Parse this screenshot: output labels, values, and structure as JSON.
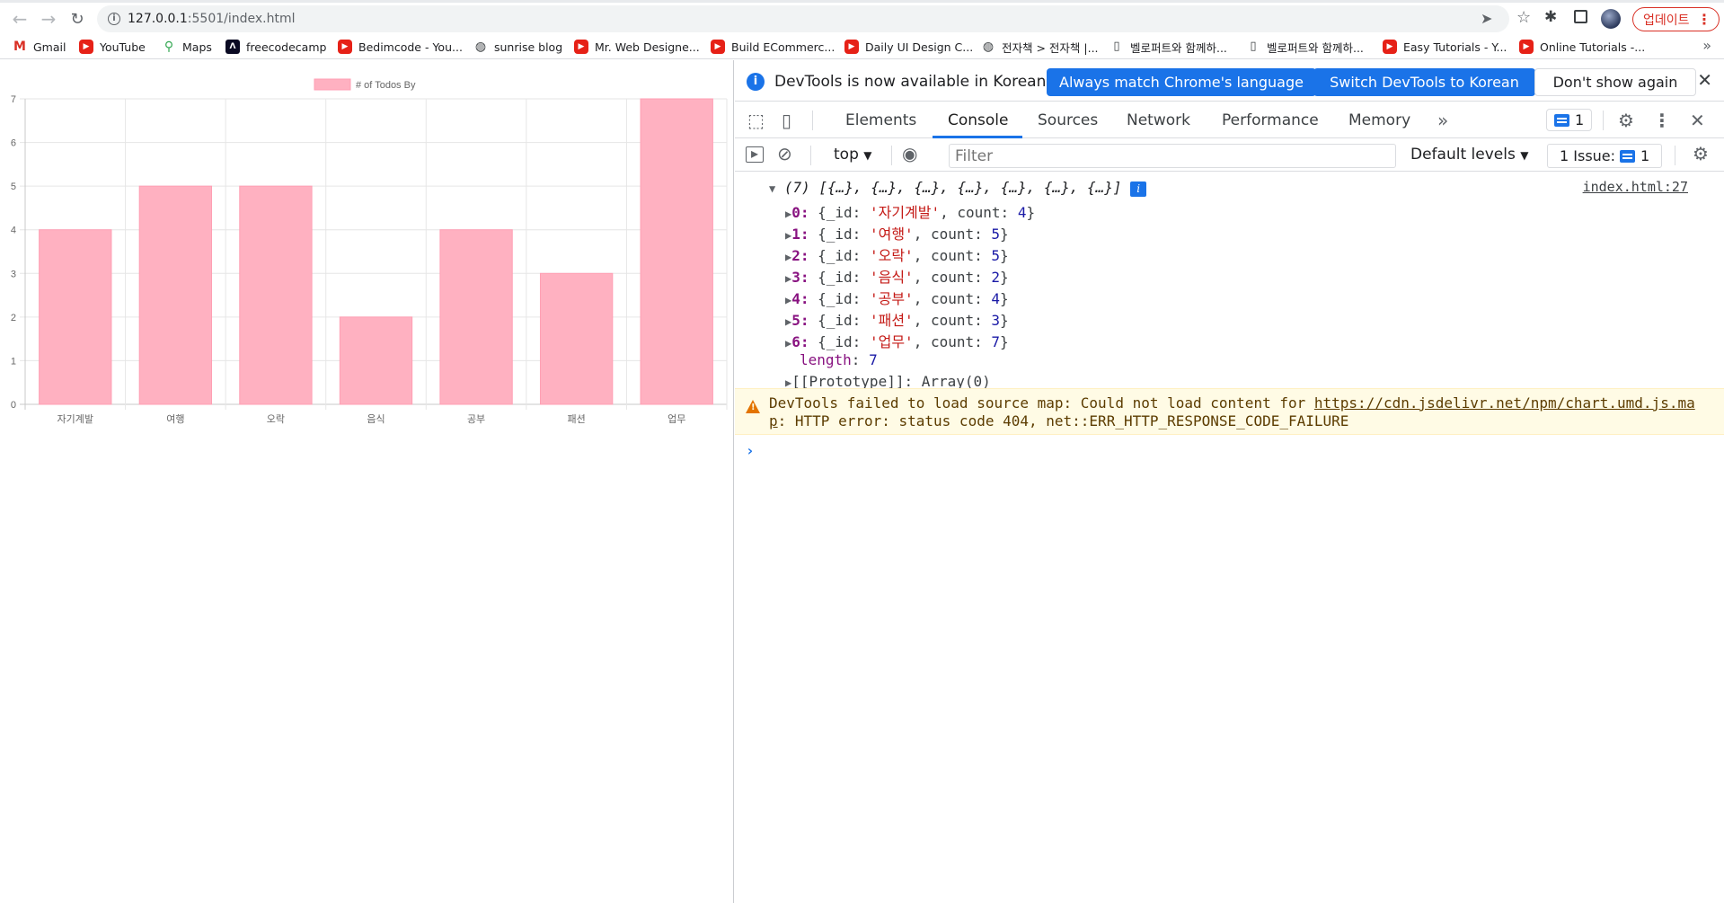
{
  "browser": {
    "url_host": "127.0.0.1",
    "url_rest": ":5501/index.html",
    "update_label": "업데이트",
    "bookmarks": [
      {
        "label": "Gmail",
        "icon": "gmail-icon"
      },
      {
        "label": "YouTube",
        "icon": "youtube-icon"
      },
      {
        "label": "Maps",
        "icon": "maps-icon"
      },
      {
        "label": "freecodecamp",
        "icon": "freecodecamp-icon"
      },
      {
        "label": "Bedimcode - You...",
        "icon": "youtube-icon"
      },
      {
        "label": "sunrise blog",
        "icon": "globe-icon"
      },
      {
        "label": "Mr. Web Designe...",
        "icon": "youtube-icon"
      },
      {
        "label": "Build ECommerc...",
        "icon": "youtube-icon"
      },
      {
        "label": "Daily UI Design C...",
        "icon": "youtube-icon"
      },
      {
        "label": "전자책 > 전자책 |...",
        "icon": "globe-icon"
      },
      {
        "label": "벨로퍼트와 함께하...",
        "icon": "book-icon"
      },
      {
        "label": "벨로퍼트와 함께하...",
        "icon": "book-icon"
      },
      {
        "label": "Easy Tutorials - Y...",
        "icon": "youtube-icon"
      },
      {
        "label": "Online Tutorials -...",
        "icon": "youtube-icon"
      }
    ]
  },
  "chart_data": {
    "type": "bar",
    "legend": "# of Todos By",
    "categories": [
      "자기계발",
      "여행",
      "오락",
      "음식",
      "공부",
      "패션",
      "업무"
    ],
    "values": [
      4,
      5,
      5,
      2,
      4,
      3,
      7
    ],
    "ylim": [
      0,
      7
    ],
    "yticks": [
      "0",
      "1",
      "2",
      "3",
      "4",
      "5",
      "6",
      "7"
    ],
    "bar_color": "#ffb1c1",
    "bar_border": "#ff9fb4",
    "grid": true,
    "legend_position": "top"
  },
  "devtools": {
    "banner_message": "DevTools is now available in Korean!",
    "btn_match": "Always match Chrome's language",
    "btn_switch": "Switch DevTools to Korean",
    "btn_dismiss": "Don't show again",
    "tabs": [
      "Elements",
      "Console",
      "Sources",
      "Network",
      "Performance",
      "Memory"
    ],
    "active_tab": "Console",
    "messages_count": "1",
    "context": "top",
    "filter_placeholder": "Filter",
    "levels": "Default levels",
    "issues_label": "1 Issue:",
    "issues_count": "1",
    "source_link": "index.html:27",
    "array_summary": "(7) [{…}, {…}, {…}, {…}, {…}, {…}, {…}]",
    "entries": [
      {
        "idx": "0",
        "id": "자기계발",
        "count": "4"
      },
      {
        "idx": "1",
        "id": "여행",
        "count": "5"
      },
      {
        "idx": "2",
        "id": "오락",
        "count": "5"
      },
      {
        "idx": "3",
        "id": "음식",
        "count": "2"
      },
      {
        "idx": "4",
        "id": "공부",
        "count": "4"
      },
      {
        "idx": "5",
        "id": "패션",
        "count": "3"
      },
      {
        "idx": "6",
        "id": "업무",
        "count": "7"
      }
    ],
    "length_label": "length",
    "length_value": "7",
    "prototype": "[[Prototype]]: Array(0)",
    "warning_prefix": "DevTools failed to load source map: Could not load content for ",
    "warning_link": "https://cdn.jsdelivr.net/npm/chart.umd.js.map",
    "warning_suffix": ": HTTP error: status code 404, net::ERR_HTTP_RESPONSE_CODE_FAILURE",
    "prompt": "›"
  }
}
